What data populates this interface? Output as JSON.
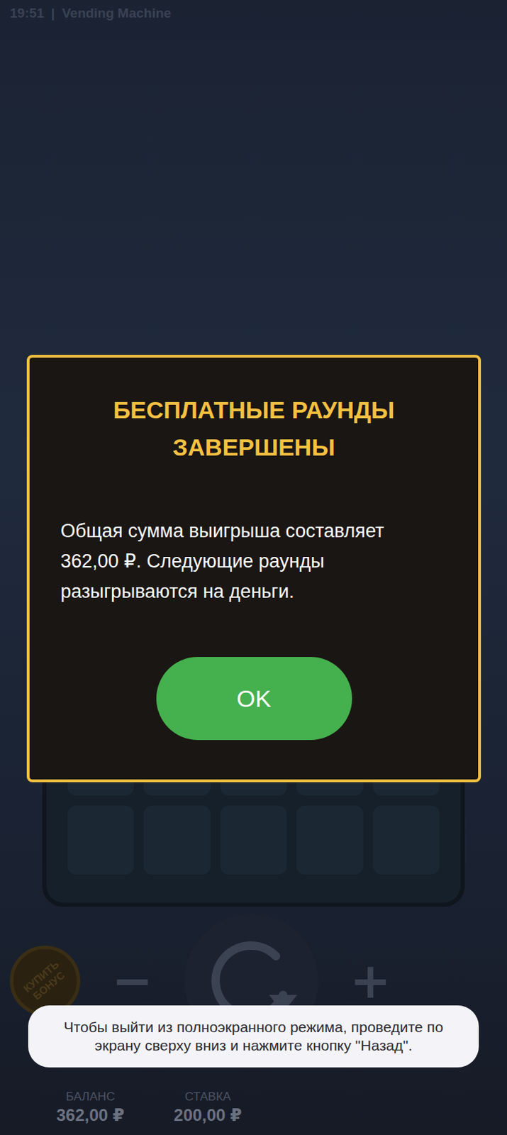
{
  "status_bar": {
    "time": "19:51",
    "separator": "|",
    "title": "Vending Machine"
  },
  "dialog": {
    "title": "БЕСПЛАТНЫЕ РАУНДЫ ЗАВЕРШЕНЫ",
    "message": "Общая сумма выигрыша составляет 362,00 ₽. Следующие раунды разыгрываются на деньги.",
    "button": "OK"
  },
  "controls": {
    "buy_bonus": "КУПИТЬ БОНУС",
    "minus": "−",
    "plus": "+"
  },
  "info": [
    {
      "label": "БАЛАНС",
      "value": "362,00 ₽"
    },
    {
      "label": "СТАВКА",
      "value": "200,00 ₽"
    }
  ],
  "toast": {
    "text": "Чтобы выйти из полноэкранного режима, проведите по экрану сверху вниз и нажмите кнопку \"Назад\"."
  }
}
